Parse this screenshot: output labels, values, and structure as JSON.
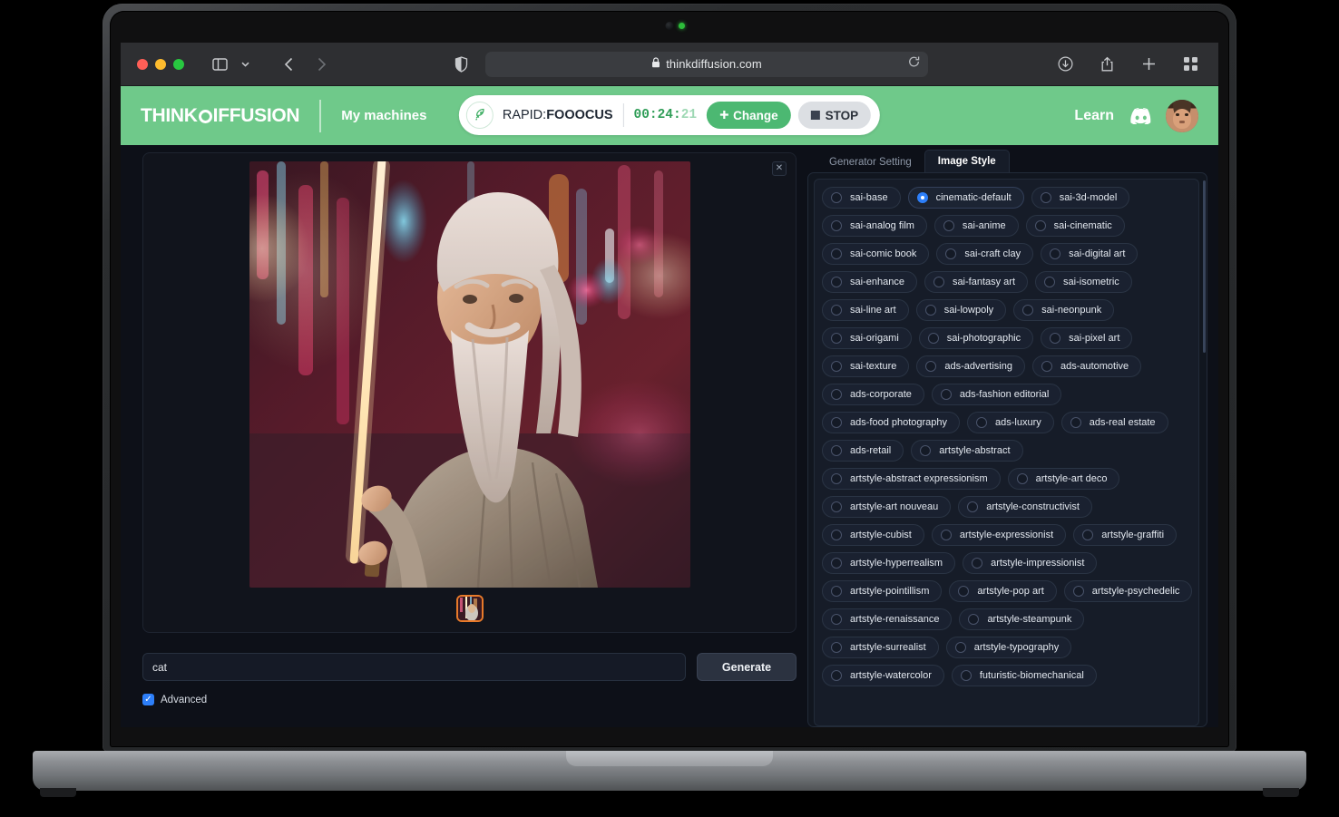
{
  "browser": {
    "url": "thinkdiffusion.com",
    "lock_icon": "lock-icon",
    "reload_icon": "reload-icon",
    "traffic_lights": [
      "close",
      "minimize",
      "maximize"
    ],
    "toolbar_icons": [
      "sidebar-icon",
      "chevron-down-icon",
      "back-icon",
      "forward-icon",
      "shield-icon",
      "download-icon",
      "share-icon",
      "new-tab-icon",
      "tab-overview-icon"
    ]
  },
  "header": {
    "logo_prefix": "THINK",
    "logo_suffix": "IFFUSION",
    "my_machines": "My machines",
    "machine": {
      "rocket_icon": "rocket-icon",
      "prefix": "RAPID:",
      "name": "FOOOCUS",
      "timer_hours_minutes": "00:24:",
      "timer_seconds": "21",
      "change_label": "Change",
      "change_icon": "plus-icon",
      "stop_label": "STOP",
      "stop_icon": "stop-square-icon"
    },
    "learn": "Learn",
    "discord_icon": "discord-icon",
    "avatar": "avatar",
    "accent_green": "#6fc98a",
    "button_green": "#4cb872"
  },
  "preview": {
    "close_icon": "close-icon",
    "image_alt": "Generated image of an elderly wizard with long white hair and beard holding a glowing staff in a neon-lit cyberpunk alley",
    "thumbnails": [
      {
        "name": "generated-thumbnail-1",
        "selected": true
      }
    ],
    "selected_border_color": "#e87a2a"
  },
  "prompt": {
    "value": "cat",
    "placeholder": "",
    "generate_label": "Generate",
    "advanced_label": "Advanced",
    "advanced_checked": true,
    "checkbox_color": "#2d7ff9"
  },
  "right_panel": {
    "tabs": [
      {
        "label": "Generator Setting",
        "active": false
      },
      {
        "label": "Image Style",
        "active": true
      }
    ],
    "selected_style": "cinematic-default",
    "styles": [
      "sai-base",
      "cinematic-default",
      "sai-3d-model",
      "sai-analog film",
      "sai-anime",
      "sai-cinematic",
      "sai-comic book",
      "sai-craft clay",
      "sai-digital art",
      "sai-enhance",
      "sai-fantasy art",
      "sai-isometric",
      "sai-line art",
      "sai-lowpoly",
      "sai-neonpunk",
      "sai-origami",
      "sai-photographic",
      "sai-pixel art",
      "sai-texture",
      "ads-advertising",
      "ads-automotive",
      "ads-corporate",
      "ads-fashion editorial",
      "ads-food photography",
      "ads-luxury",
      "ads-real estate",
      "ads-retail",
      "artstyle-abstract",
      "artstyle-abstract expressionism",
      "artstyle-art deco",
      "artstyle-art nouveau",
      "artstyle-constructivist",
      "artstyle-cubist",
      "artstyle-expressionist",
      "artstyle-graffiti",
      "artstyle-hyperrealism",
      "artstyle-impressionist",
      "artstyle-pointillism",
      "artstyle-pop art",
      "artstyle-psychedelic",
      "artstyle-renaissance",
      "artstyle-steampunk",
      "artstyle-surrealist",
      "artstyle-typography",
      "artstyle-watercolor",
      "futuristic-biomechanical"
    ]
  }
}
